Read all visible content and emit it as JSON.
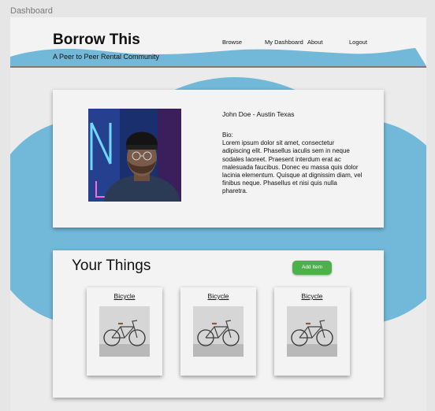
{
  "frame": {
    "label": "Dashboard"
  },
  "header": {
    "logo": "Borrow This",
    "tagline": "A Peer to Peer Rental Community",
    "nav": [
      {
        "label": "Browse"
      },
      {
        "label": "My Dashboard"
      },
      {
        "label": "About"
      },
      {
        "label": "Logout"
      }
    ]
  },
  "profile": {
    "name": "John Doe - Austin Texas",
    "bio": "Bio:\nLorem ipsum dolor sit amet, consectetur adipiscing elit. Phasellus iaculis sem in neque sodales laoreet. Praesent interdum erat ac malesuada faucibus. Donec eu massa quis dolor lacinia elementum. Quisque at dignissim diam, vel finibus neque. Phasellus et nisi quis nulla pharetra."
  },
  "things": {
    "title": "Your Things",
    "add_button": "Add Item",
    "items": [
      {
        "title": "Bicycle"
      },
      {
        "title": "Bicycle"
      },
      {
        "title": "Bicycle"
      }
    ]
  },
  "colors": {
    "accent_blue": "#72b8d9",
    "button_green": "#4db04a"
  }
}
